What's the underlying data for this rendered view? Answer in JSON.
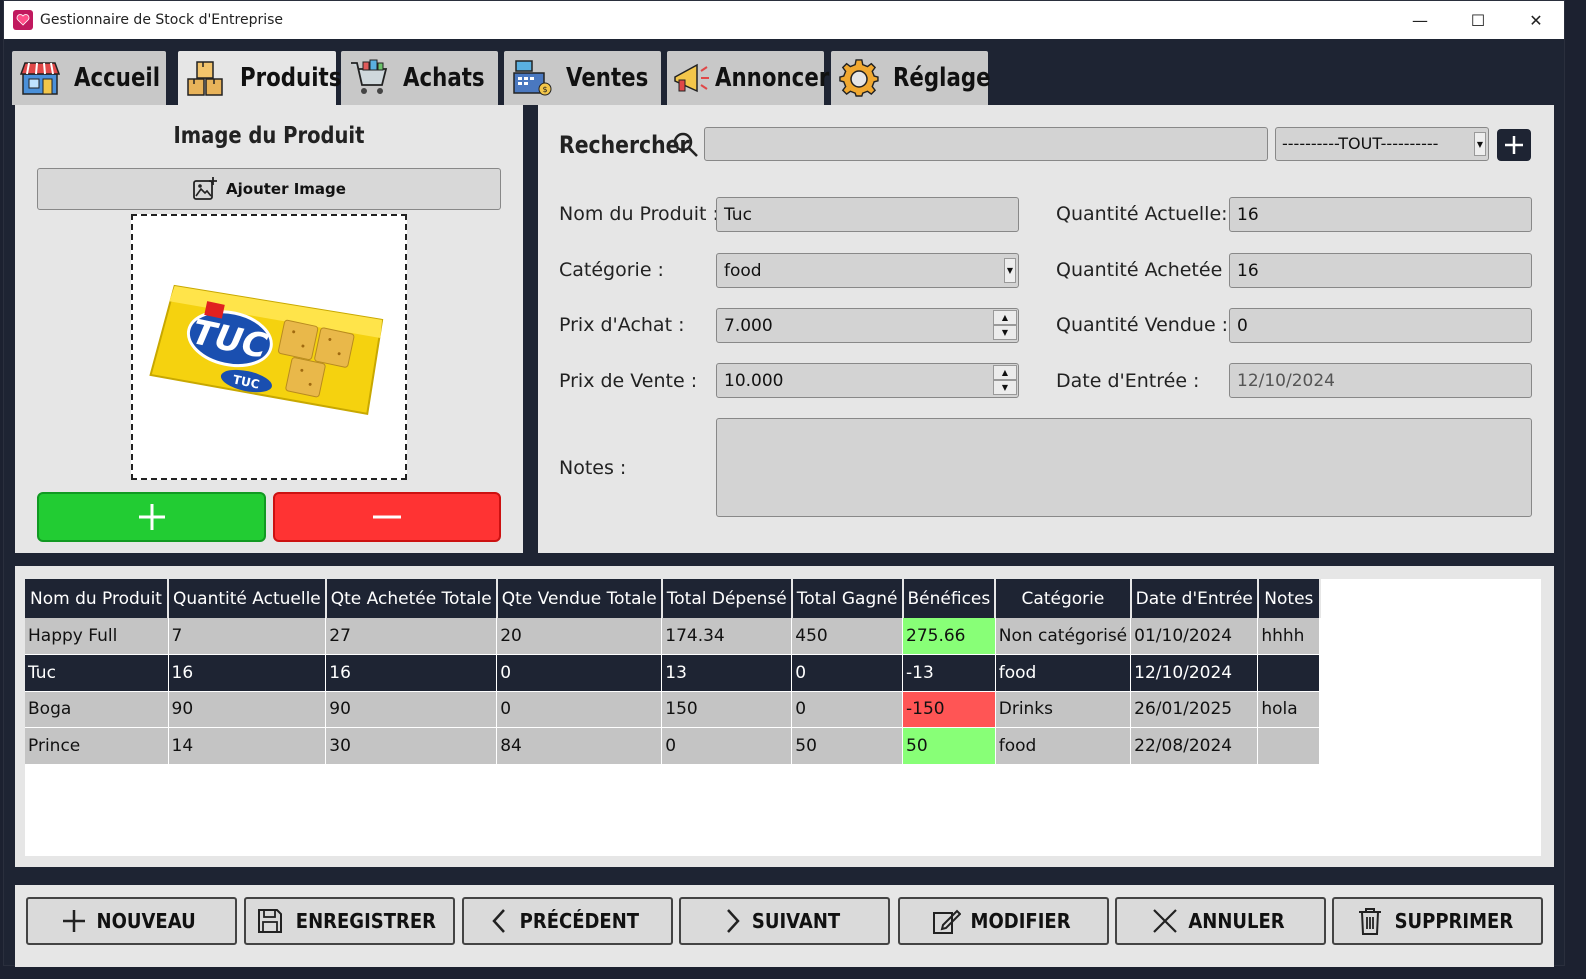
{
  "window": {
    "title": "Gestionnaire de Stock d'Entreprise",
    "controls": {
      "minimize": "—",
      "maximize": "☐",
      "close": "✕"
    }
  },
  "tabs": [
    {
      "label": "Accueil",
      "icon": "store-icon"
    },
    {
      "label": "Produits",
      "icon": "boxes-icon",
      "active": true
    },
    {
      "label": "Achats",
      "icon": "cart-icon"
    },
    {
      "label": "Ventes",
      "icon": "cash-register-icon"
    },
    {
      "label": "Annoncer",
      "icon": "megaphone-icon"
    },
    {
      "label": "Réglage",
      "icon": "gear-icon"
    }
  ],
  "image_panel": {
    "title": "Image du Produit",
    "add_image_label": "Ajouter Image",
    "add_button": "+",
    "remove_button": "−"
  },
  "search": {
    "label": "Rechercher",
    "value": "",
    "category_filter": "----------TOUT----------"
  },
  "form": {
    "nom_label": "Nom du Produit :",
    "nom_value": "Tuc",
    "categorie_label": "Catégorie :",
    "categorie_value": "food",
    "prix_achat_label": "Prix d'Achat :",
    "prix_achat_value": "7.000",
    "prix_vente_label": "Prix de Vente :",
    "prix_vente_value": "10.000",
    "notes_label": "Notes :",
    "notes_value": "",
    "qte_actuelle_label": "Quantité Actuelle:",
    "qte_actuelle_value": "16",
    "qte_achetee_label": "Quantité Achetée :",
    "qte_achetee_value": "16",
    "qte_vendue_label": "Quantité Vendue :",
    "qte_vendue_value": "0",
    "date_label": "Date d'Entrée :",
    "date_value": "12/10/2024"
  },
  "table": {
    "headers": [
      "Nom du Produit",
      "Quantité Actuelle",
      "Qte Achetée Totale",
      "Qte Vendue Totale",
      "Total Dépensé",
      "Total Gagné",
      "Bénéfices",
      "Catégorie",
      "Date d'Entrée",
      "Notes"
    ],
    "rows": [
      [
        "Happy Full",
        "7",
        "27",
        "20",
        "174.34",
        "450",
        "275.66",
        "Non catégorisé",
        "01/10/2024",
        "hhhh"
      ],
      [
        "Tuc",
        "16",
        "16",
        "0",
        "13",
        "0",
        "-13",
        "food",
        "12/10/2024",
        ""
      ],
      [
        "Boga",
        "90",
        "90",
        "0",
        "150",
        "0",
        "-150",
        "Drinks",
        "26/01/2025",
        "hola"
      ],
      [
        "Prince",
        "14",
        "30",
        "84",
        "0",
        "50",
        "50",
        "food",
        "22/08/2024",
        ""
      ]
    ],
    "selected_row": 1,
    "profit_status": [
      "positive",
      "neutral",
      "negative",
      "positive"
    ]
  },
  "actions": {
    "nouveau": "NOUVEAU",
    "enregistrer": "ENREGISTRER",
    "precedent": "PRÉCÉDENT",
    "suivant": "SUIVANT",
    "modifier": "MODIFIER",
    "annuler": "ANNULER",
    "supprimer": "SUPPRIMER"
  },
  "colors": {
    "dark_bg": "#1e2433",
    "panel_bg": "#e6e6e6",
    "add_green": "#22cc33",
    "remove_red": "#ff3333",
    "profit_green": "#88ff77",
    "loss_red": "#ff5555"
  }
}
